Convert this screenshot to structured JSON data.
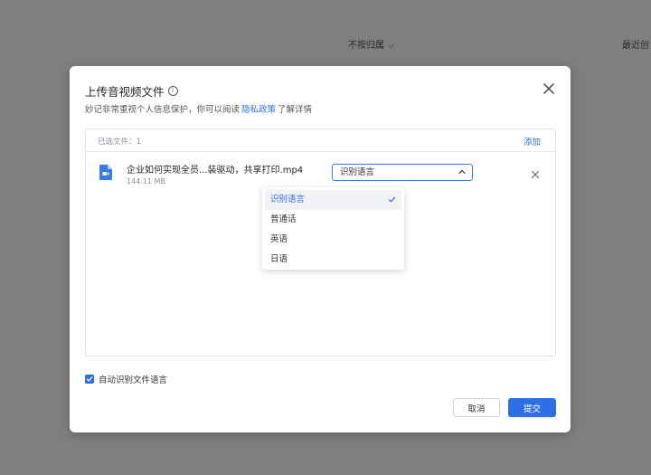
{
  "background": {
    "filter_label": "不按归属",
    "recent_label": "最近创"
  },
  "dialog": {
    "title": "上传音视频文件",
    "subtitle_prefix": "妙记非常重视个人信息保护，你可以阅读",
    "privacy_link": "隐私政策",
    "subtitle_suffix": "了解详情"
  },
  "file_list": {
    "selected_count": "已选文件：1",
    "add_label": "添加",
    "files": [
      {
        "name": "企业如何实现全员...装驱动，共享打印.mp4",
        "size": "144.11 MB",
        "language": "识别语言"
      }
    ]
  },
  "language_dropdown": {
    "options": [
      "识别语言",
      "普通话",
      "英语",
      "日语"
    ],
    "selected": "识别语言"
  },
  "footer": {
    "auto_detect_label": "自动识别文件语言",
    "auto_detect_checked": true,
    "cancel_label": "取消",
    "submit_label": "提交"
  },
  "colors": {
    "accent": "#2f6fe4",
    "overlay": "#7f7f7f"
  }
}
